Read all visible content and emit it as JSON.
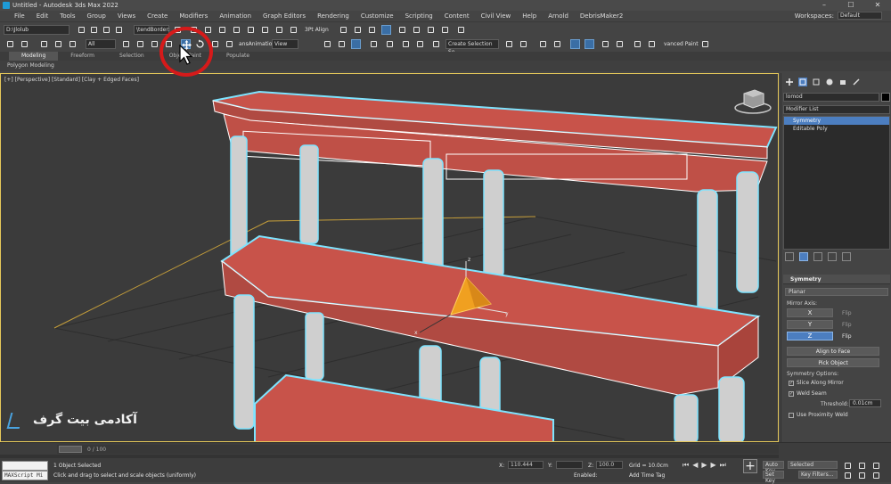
{
  "window": {
    "title": "Untitled - Autodesk 3ds Max 2022",
    "minimize": "–",
    "maximize": "☐",
    "close": "✕"
  },
  "menu": {
    "items": [
      "File",
      "Edit",
      "Tools",
      "Group",
      "Views",
      "Create",
      "Modifiers",
      "Animation",
      "Graph Editors",
      "Rendering",
      "Customize",
      "Scripting",
      "Content",
      "Civil View",
      "Help",
      "Arnold",
      "DebrisMaker2"
    ],
    "workspaces_label": "Workspaces:",
    "workspaces_value": "Default"
  },
  "toolbar1": {
    "path_field": "D:\\Jlolub",
    "filter_field": "\\tendBorder:",
    "align_label": "3Pt Align"
  },
  "toolbar2": {
    "layer_field": "All",
    "ref_coord": "View",
    "anim_label": "ansAnimation",
    "selection_set": "Create Selection Se",
    "advanced_label": "vanced Paint"
  },
  "ribbon": {
    "tabs": [
      "Modeling",
      "Freeform",
      "Selection",
      "Object Paint",
      "Populate"
    ],
    "active_tab": "Modeling",
    "sub_label": "Polygon Modeling"
  },
  "viewport": {
    "label": "[+] [Perspective] [Standard] [Clay + Edged Faces]",
    "watermark": "آکادمی بیت گرف",
    "axis_x": "x",
    "axis_y": "y",
    "axis_z": "z"
  },
  "command_panel": {
    "object_name": "lomod",
    "modifier_list": "Modifier List",
    "stack": [
      {
        "label": "Symmetry",
        "selected": true
      },
      {
        "label": "Editable Poly",
        "selected": false
      }
    ],
    "rollout_title": "Symmetry",
    "planar_label": "Planar",
    "mirror_axis_label": "Mirror Axis:",
    "axes": [
      {
        "label": "X",
        "active": false,
        "flip": "Flip"
      },
      {
        "label": "Y",
        "active": false,
        "flip": "Flip"
      },
      {
        "label": "Z",
        "active": true,
        "flip": "Flip"
      }
    ],
    "align_to_face": "Align to Face",
    "pick_object": "Pick Object",
    "symmetry_options": "Symmetry Options:",
    "slice_along_mirror": "Slice Along Mirror",
    "weld_seam": "Weld Seam",
    "threshold_label": "Threshold:",
    "threshold_value": "0.01cm",
    "use_proximity_weld": "Use Proximity Weld"
  },
  "status": {
    "time_slider": "0 / 100",
    "maxscript": "MAXScript Mi",
    "selected_text": "1 Object Selected",
    "prompt_text": "Click and drag to select and scale objects (uniformly)",
    "x_label": "X:",
    "x_value": "110.444",
    "y_label": "Y:",
    "y_value": "",
    "z_label": "Z:",
    "z_value": "100.0",
    "grid": "Grid = 10.0cm",
    "enabled_label": "Enabled:",
    "add_time_tag": "Add Time Tag",
    "auto_key": "Auto Key",
    "set_key": "Set Key",
    "selected_dropdown": "Selected",
    "key_filters": "Key Filters..."
  },
  "colors": {
    "furniture_fill": "#c8534a",
    "wire": "#ffffff",
    "selection_outline": "#7ee4ff",
    "gizmo": "#f0a020",
    "highlight": "#4c7ec0",
    "annotation": "#d61a1a"
  }
}
